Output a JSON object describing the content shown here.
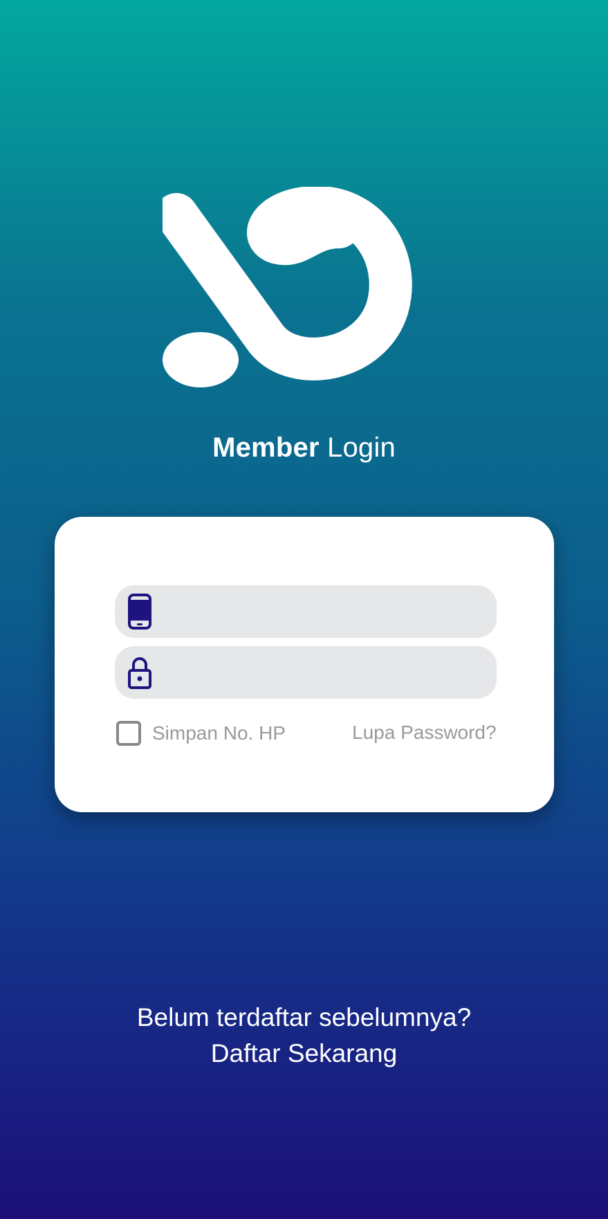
{
  "brand": {
    "logo": "brand-logo"
  },
  "title": {
    "bold": "Member",
    "regular": "Login"
  },
  "login": {
    "phone_icon": "phone-icon",
    "phone_value": "",
    "password_icon": "lock-icon",
    "password_value": "",
    "remember_label": "Simpan No. HP",
    "remember_checked": false,
    "forgot_label": "Lupa Password?"
  },
  "register": {
    "prompt": "Belum terdaftar sebelumnya?",
    "link_label": "Daftar Sekarang"
  },
  "colors": {
    "gradient_top": "#03a89e",
    "gradient_bottom": "#1c1077",
    "icon": "#1f1380",
    "field_bg": "#e6e7e9"
  }
}
